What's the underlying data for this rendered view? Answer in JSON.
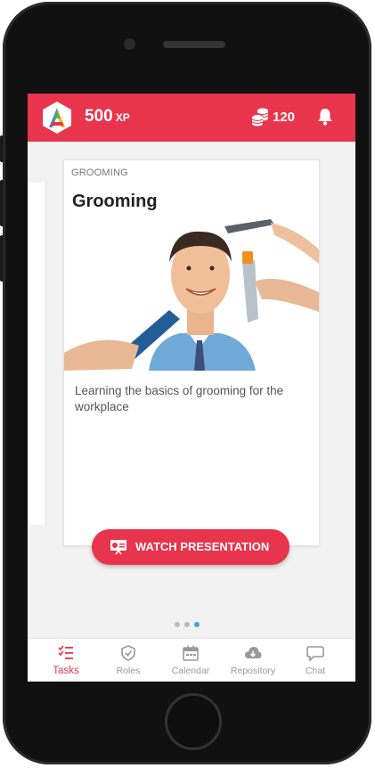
{
  "app": {
    "xp_value": "500",
    "xp_unit": "XP",
    "coins": "120"
  },
  "card": {
    "category": "GROOMING",
    "title": "Grooming",
    "description": "Learning the basics of grooming for the workplace"
  },
  "cta": {
    "label": "WATCH PRESENTATION"
  },
  "pager": {
    "count": 3,
    "active_index": 2
  },
  "tabs": [
    {
      "label": "Tasks",
      "icon": "tasks-icon",
      "active": true
    },
    {
      "label": "Roles",
      "icon": "roles-icon",
      "active": false
    },
    {
      "label": "Calendar",
      "icon": "calendar-icon",
      "active": false
    },
    {
      "label": "Repository",
      "icon": "cloud-icon",
      "active": false
    },
    {
      "label": "Chat",
      "icon": "chat-icon",
      "active": false
    }
  ],
  "colors": {
    "brand": "#e8344d",
    "pager_active": "#3aa7e8",
    "tab_inactive": "#999999"
  }
}
